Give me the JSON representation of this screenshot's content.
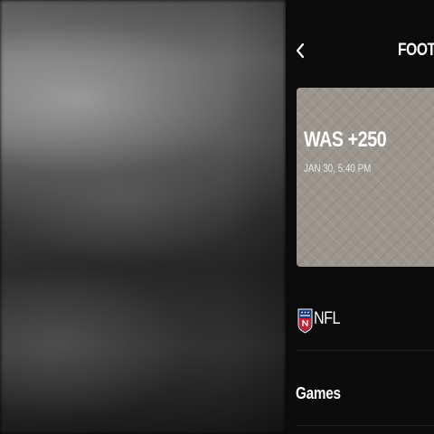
{
  "header": {
    "title": "FOOTBALL",
    "back_icon": "chevron-left-icon"
  },
  "featured_bet": {
    "line": "WAS +250",
    "time": "JAN 30, 5:40 PM"
  },
  "menu": {
    "items": [
      {
        "label": "NFL",
        "icon": "nfl-shield-icon"
      },
      {
        "label": "Games"
      }
    ]
  },
  "colors": {
    "panel_bg": "#0c0b0c",
    "card_bg": "#9b968d",
    "nfl_blue": "#1a3a7a",
    "nfl_red": "#c8202e",
    "text": "#ffffff"
  }
}
